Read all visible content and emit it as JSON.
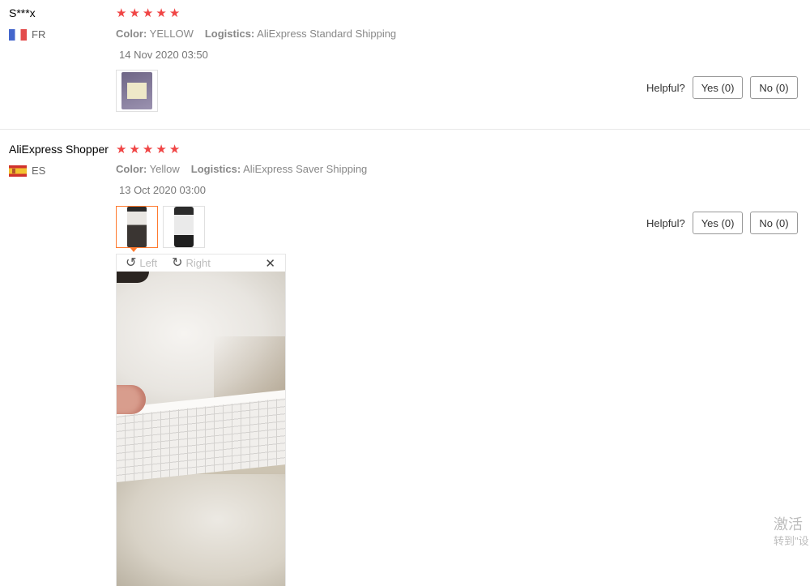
{
  "reviews": [
    {
      "user": "S***x",
      "country": "FR",
      "rating": 5,
      "color_key": "Color:",
      "color_value": "YELLOW",
      "logistics_key": "Logistics:",
      "logistics_value": "AliExpress Standard Shipping",
      "date": "14 Nov 2020 03:50",
      "helpful_label": "Helpful?",
      "yes_label": "Yes (0)",
      "no_label": "No (0)"
    },
    {
      "user": "AliExpress Shopper",
      "country": "ES",
      "rating": 5,
      "color_key": "Color:",
      "color_value": "Yellow",
      "logistics_key": "Logistics:",
      "logistics_value": "AliExpress Saver Shipping",
      "date": "13 Oct 2020 03:00",
      "helpful_label": "Helpful?",
      "yes_label": "Yes (0)",
      "no_label": "No (0)"
    }
  ],
  "viewer": {
    "rotate_left_icon": "↺",
    "rotate_left_label": "Left",
    "rotate_right_icon": "↻",
    "rotate_right_label": "Right",
    "close_icon": "✕"
  },
  "star_char": "★",
  "watermark": {
    "line1": "激活",
    "line2": "转到\"设"
  }
}
